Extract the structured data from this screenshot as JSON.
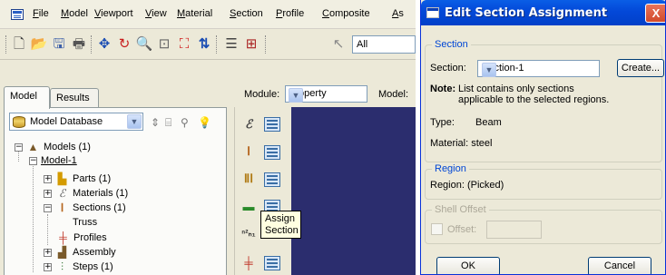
{
  "cae": {
    "menu": [
      "File",
      "Model",
      "Viewport",
      "View",
      "Material",
      "Section",
      "Profile",
      "Composite",
      "As"
    ],
    "toolbar": {
      "icons": [
        "new-file-icon",
        "open-folder-icon",
        "save-icon",
        "print-icon",
        "pan-icon",
        "rotate-icon",
        "zoom-icon",
        "box-zoom-icon",
        "auto-fit-icon",
        "cycle-views-icon",
        "query-icon",
        "plot-icon",
        "select-icon"
      ],
      "filter_value": "All"
    },
    "tabs": {
      "model": "Model",
      "results": "Results"
    },
    "database_combo": "Model Database",
    "tree": {
      "models": "Models (1)",
      "model": "Model-1",
      "parts": "Parts (1)",
      "materials": "Materials (1)",
      "sections": "Sections (1)",
      "truss": "Truss",
      "profiles": "Profiles",
      "assembly": "Assembly",
      "steps": "Steps (1)"
    },
    "module_label": "Module:",
    "module_value": "Property",
    "model_label": "Model:",
    "tooltip": {
      "line1": "Assign",
      "line2": "Section"
    },
    "colors": {
      "viewport": "#2b2d6e"
    }
  },
  "dialog": {
    "title": "Edit Section Assignment",
    "close": "X",
    "section_group": "Section",
    "section_label": "Section:",
    "section_value": "Section-1",
    "create_button": "Create...",
    "note_label": "Note:",
    "note_line1": "List contains only sections",
    "note_line2": "applicable to the selected regions.",
    "type_label": "Type:",
    "type_value": "Beam",
    "material_text": "Material: steel",
    "region_group": "Region",
    "region_text": "Region: (Picked)",
    "shell_group": "Shell Offset",
    "offset_label": "Offset:",
    "ok_button": "OK",
    "cancel_button": "Cancel"
  }
}
